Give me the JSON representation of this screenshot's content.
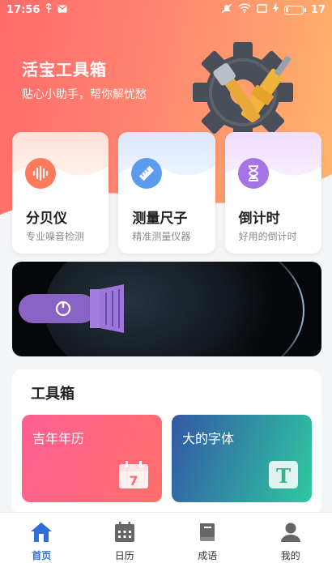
{
  "status_bar": {
    "time": "17:56",
    "battery": "17"
  },
  "header": {
    "title": "活宝工具箱",
    "subtitle": "贴心小助手，帮你解忧愁"
  },
  "feature_cards": [
    {
      "title": "分贝仪",
      "subtitle": "专业噪音检测",
      "icon": "sound-wave-icon",
      "color": "#ff7a5c"
    },
    {
      "title": "测量尺子",
      "subtitle": "精准测量仪器",
      "icon": "ruler-icon",
      "color": "#5b9cf0"
    },
    {
      "title": "倒计时",
      "subtitle": "好用的倒计时",
      "icon": "hourglass-icon",
      "color": "#a774e8"
    }
  ],
  "banner": {
    "icon": "flashlight-icon"
  },
  "toolbox": {
    "title": "工具箱",
    "items": [
      {
        "label": "吉年年历",
        "icon": "calendar-icon",
        "icon_text": "7"
      },
      {
        "label": "大的字体",
        "icon": "big-font-icon",
        "icon_text": "T"
      }
    ]
  },
  "tabbar": {
    "tabs": [
      {
        "label": "首页",
        "icon": "home-icon",
        "active": true
      },
      {
        "label": "日历",
        "icon": "calendar-tab-icon",
        "active": false
      },
      {
        "label": "成语",
        "icon": "book-icon",
        "active": false
      },
      {
        "label": "我的",
        "icon": "user-icon",
        "active": false
      }
    ]
  }
}
